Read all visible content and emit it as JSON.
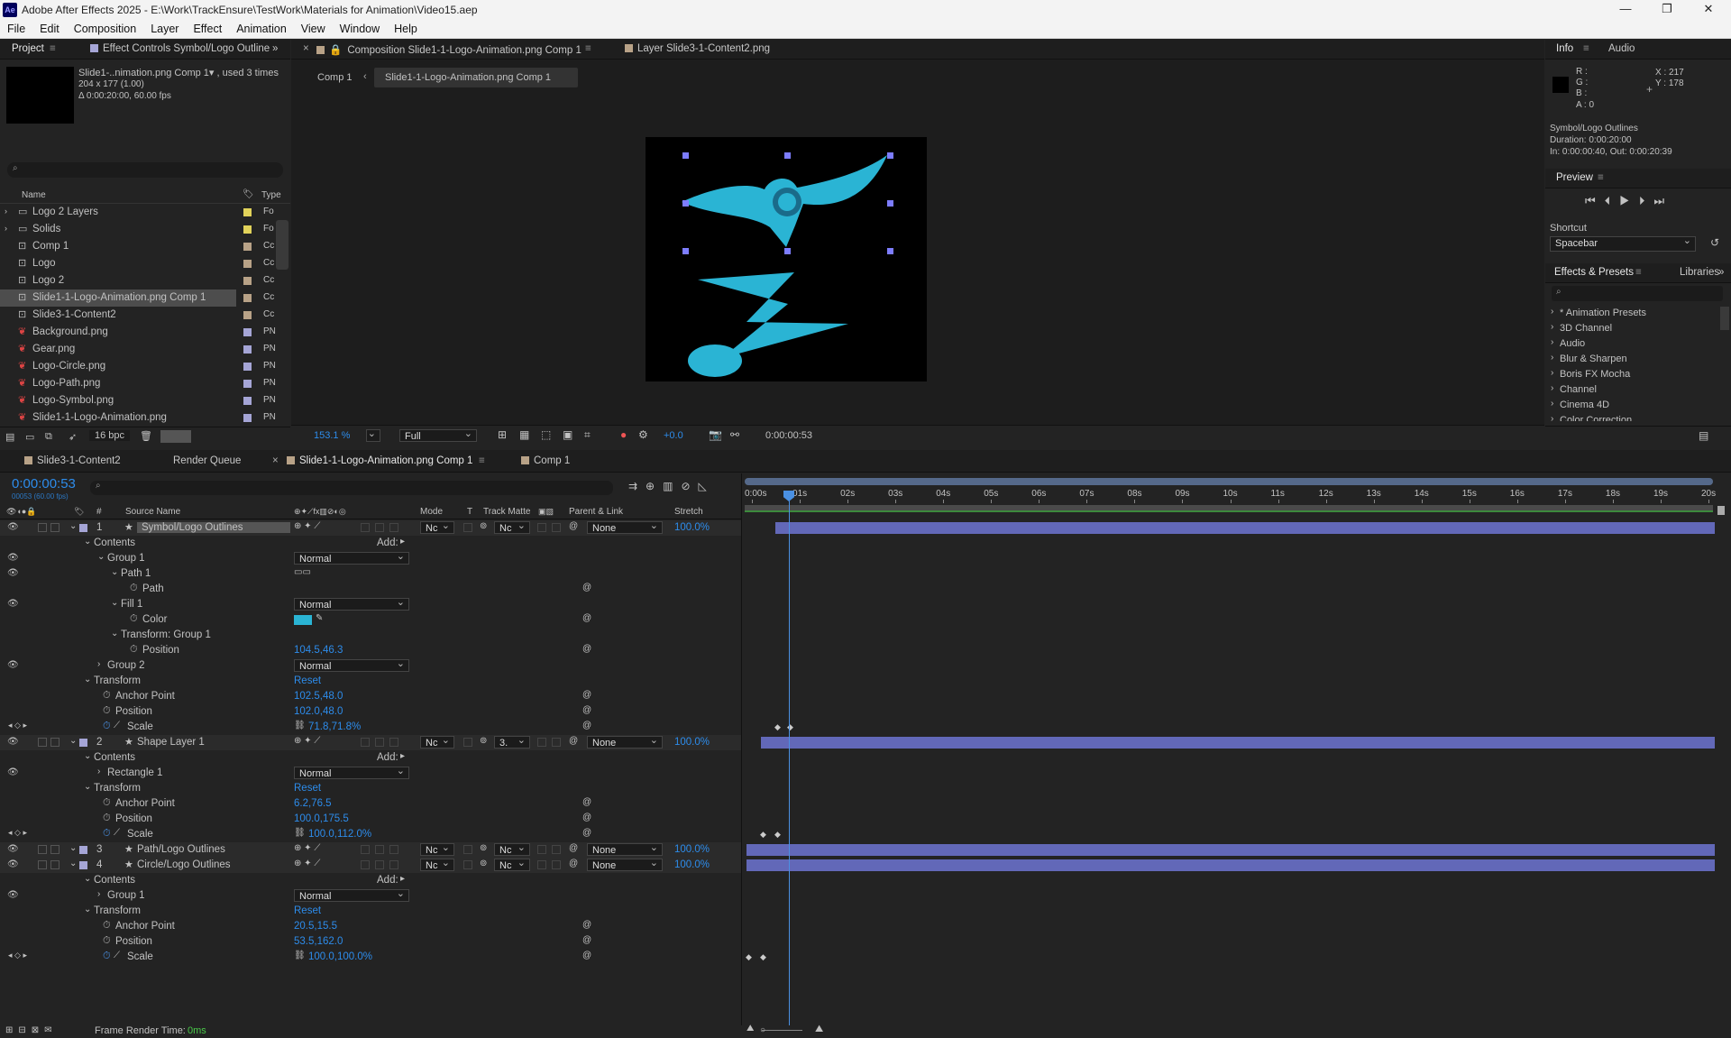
{
  "app": {
    "title": "Adobe After Effects 2025 - E:\\Work\\TrackEnsure\\TestWork\\Materials for Animation\\Video15.aep",
    "logo": "Ae"
  },
  "menu": [
    "File",
    "Edit",
    "Composition",
    "Layer",
    "Effect",
    "Animation",
    "View",
    "Window",
    "Help"
  ],
  "project": {
    "tab": "Project",
    "tab2": "Effect Controls Symbol/Logo Outline",
    "item_name": "Slide1-..nimation.png Comp 1▾ , used 3 times",
    "item_dims": "204 x 177 (1.00)",
    "item_dur": "Δ 0:00:20:00, 60.00 fps",
    "col_name": "Name",
    "col_type": "Type",
    "items": [
      {
        "name": "Logo 2 Layers",
        "type": "Fo",
        "kind": "folder",
        "color": "#e1d25a"
      },
      {
        "name": "Solids",
        "type": "Fo",
        "kind": "folder",
        "color": "#e1d25a"
      },
      {
        "name": "Comp 1",
        "type": "Cc",
        "kind": "comp",
        "color": "#b8a287"
      },
      {
        "name": "Logo",
        "type": "Cc",
        "kind": "comp",
        "color": "#b8a287"
      },
      {
        "name": "Logo 2",
        "type": "Cc",
        "kind": "comp",
        "color": "#b8a287"
      },
      {
        "name": "Slide1-1-Logo-Animation.png Comp 1",
        "type": "Cc",
        "kind": "comp",
        "color": "#b8a287",
        "selected": true
      },
      {
        "name": "Slide3-1-Content2",
        "type": "Cc",
        "kind": "comp",
        "color": "#b8a287"
      },
      {
        "name": "Background.png",
        "type": "PN",
        "kind": "png",
        "color": "#a5a5d6"
      },
      {
        "name": "Gear.png",
        "type": "PN",
        "kind": "png",
        "color": "#a5a5d6"
      },
      {
        "name": "Logo-Circle.png",
        "type": "PN",
        "kind": "png",
        "color": "#a5a5d6"
      },
      {
        "name": "Logo-Path.png",
        "type": "PN",
        "kind": "png",
        "color": "#a5a5d6"
      },
      {
        "name": "Logo-Symbol.png",
        "type": "PN",
        "kind": "png",
        "color": "#a5a5d6"
      },
      {
        "name": "Slide1-1-Logo-Animation.png",
        "type": "PN",
        "kind": "png",
        "color": "#a5a5d6"
      }
    ],
    "bpc": "16 bpc"
  },
  "viewer": {
    "tab1": "Composition Slide1-1-Logo-Animation.png Comp 1",
    "tab2": "Layer Slide3-1-Content2.png",
    "crumb1": "Comp 1",
    "crumb2": "Slide1-1-Logo-Animation.png Comp 1",
    "zoom": "153.1 %",
    "quality": "Full",
    "exposure": "+0.0",
    "time": "0:00:00:53"
  },
  "info": {
    "tab": "Info",
    "tab2": "Audio",
    "r": "R :",
    "g": "G :",
    "b": "B :",
    "a": "A :  0",
    "x": "X : 217",
    "y": "Y : 178",
    "layer": "Symbol/Logo Outlines",
    "duration": "Duration: 0:00:20:00",
    "inout": "In: 0:00:00:40, Out: 0:00:20:39"
  },
  "preview": {
    "tab": "Preview",
    "shortcut_label": "Shortcut",
    "shortcut": "Spacebar"
  },
  "effects": {
    "tab": "Effects & Presets",
    "tab2": "Libraries",
    "items": [
      "* Animation Presets",
      "3D Channel",
      "Audio",
      "Blur & Sharpen",
      "Boris FX Mocha",
      "Channel",
      "Cinema 4D",
      "Color Correction"
    ]
  },
  "timeline": {
    "tabs": [
      "Slide3-1-Content2",
      "Render Queue",
      "Slide1-1-Logo-Animation.png Comp 1",
      "Comp 1"
    ],
    "time": "0:00:00:53",
    "fps": "00053 (60.00 fps)",
    "cols": {
      "source": "Source Name",
      "mode": "Mode",
      "t": "T",
      "matte": "Track Matte",
      "parent": "Parent & Link",
      "stretch": "Stretch",
      "num": "#"
    },
    "ruler": [
      "0:00s",
      "01s",
      "02s",
      "03s",
      "04s",
      "05s",
      "06s",
      "07s",
      "08s",
      "09s",
      "10s",
      "11s",
      "12s",
      "13s",
      "14s",
      "15s",
      "16s",
      "17s",
      "18s",
      "19s",
      "20s"
    ],
    "rows": [
      {
        "t": "layer",
        "num": "1",
        "name": "Symbol/Logo Outlines",
        "mode": "Nc",
        "matte": "Nc",
        "parent": "None",
        "stretch": "100.0%",
        "color": "#a5a5d6"
      },
      {
        "t": "prop",
        "d": 1,
        "label": "Contents",
        "add": "Add:"
      },
      {
        "t": "prop",
        "d": 2,
        "label": "Group 1",
        "dd": "Normal",
        "eye": true
      },
      {
        "t": "prop",
        "d": 3,
        "label": "Path 1",
        "eye": true
      },
      {
        "t": "prop",
        "d": 4,
        "label": "Path",
        "sw": true
      },
      {
        "t": "prop",
        "d": 3,
        "label": "Fill 1",
        "dd": "Normal",
        "eye": true
      },
      {
        "t": "prop",
        "d": 4,
        "label": "Color",
        "sw": true,
        "color": "#2ab4d4"
      },
      {
        "t": "prop",
        "d": 3,
        "label": "Transform: Group 1"
      },
      {
        "t": "prop",
        "d": 4,
        "label": "Position",
        "val": "104.5,46.3",
        "sw": true
      },
      {
        "t": "prop",
        "d": 2,
        "label": "Group 2",
        "dd": "Normal",
        "eye": true
      },
      {
        "t": "prop",
        "d": 1,
        "label": "Transform",
        "reset": "Reset"
      },
      {
        "t": "prop",
        "d": 2,
        "label": "Anchor Point",
        "val": "102.5,48.0",
        "sw": true
      },
      {
        "t": "prop",
        "d": 2,
        "label": "Position",
        "val": "102.0,48.0",
        "sw": true
      },
      {
        "t": "prop",
        "d": 2,
        "label": "Scale",
        "val": "71.8,71.8%",
        "sw": true,
        "kf": true
      },
      {
        "t": "layer",
        "num": "2",
        "name": "Shape Layer 1",
        "mode": "Nc",
        "matte": "3.",
        "parent": "None",
        "stretch": "100.0%",
        "color": "#a5a5d6"
      },
      {
        "t": "prop",
        "d": 1,
        "label": "Contents",
        "add": "Add:"
      },
      {
        "t": "prop",
        "d": 2,
        "label": "Rectangle 1",
        "dd": "Normal",
        "eye": true
      },
      {
        "t": "prop",
        "d": 1,
        "label": "Transform",
        "reset": "Reset"
      },
      {
        "t": "prop",
        "d": 2,
        "label": "Anchor Point",
        "val": "6.2,76.5",
        "sw": true
      },
      {
        "t": "prop",
        "d": 2,
        "label": "Position",
        "val": "100.0,175.5",
        "sw": true
      },
      {
        "t": "prop",
        "d": 2,
        "label": "Scale",
        "val": "100.0,112.0%",
        "sw": true,
        "kf": true
      },
      {
        "t": "layer",
        "num": "3",
        "name": "Path/Logo Outlines",
        "mode": "Nc",
        "matte": "Nc",
        "parent": "None",
        "stretch": "100.0%",
        "color": "#a5a5d6"
      },
      {
        "t": "layer",
        "num": "4",
        "name": "Circle/Logo Outlines",
        "mode": "Nc",
        "matte": "Nc",
        "parent": "None",
        "stretch": "100.0%",
        "color": "#a5a5d6"
      },
      {
        "t": "prop",
        "d": 1,
        "label": "Contents",
        "add": "Add:"
      },
      {
        "t": "prop",
        "d": 2,
        "label": "Group 1",
        "dd": "Normal",
        "eye": true
      },
      {
        "t": "prop",
        "d": 1,
        "label": "Transform",
        "reset": "Reset"
      },
      {
        "t": "prop",
        "d": 2,
        "label": "Anchor Point",
        "val": "20.5,15.5",
        "sw": true
      },
      {
        "t": "prop",
        "d": 2,
        "label": "Position",
        "val": "53.5,162.0",
        "sw": true
      },
      {
        "t": "prop",
        "d": 2,
        "label": "Scale",
        "val": "100.0,100.0%",
        "sw": true,
        "kf": true
      }
    ],
    "render_label": "Frame Render Time:",
    "render_val": "0ms"
  }
}
